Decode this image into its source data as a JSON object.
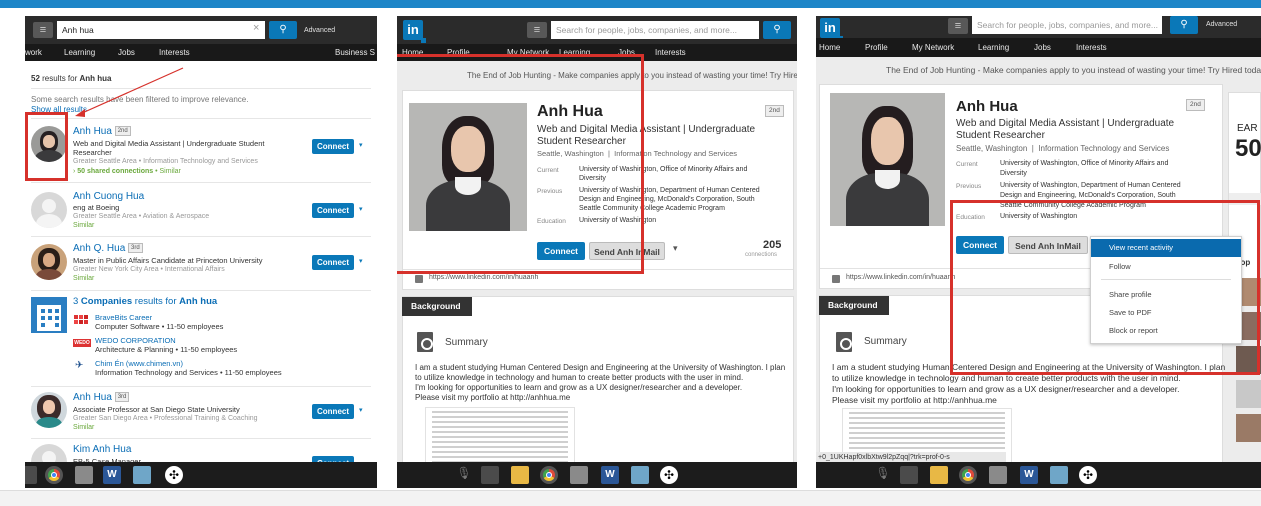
{
  "colors": {
    "accent": "#0a78b8",
    "highlight_box": "#d6312b",
    "shared": "#6aa83c"
  },
  "search_panel": {
    "query": "Anh hua",
    "clear_label": "×",
    "advanced_label": "Advanced",
    "nav": [
      "work",
      "Learning",
      "Jobs",
      "Interests",
      "Business S"
    ],
    "results_count": "52",
    "results_text": " results for ",
    "results_query": "Anh hua",
    "filter_notice": "Some search results have been filtered to improve relevance.",
    "show_all_label": "Show all results",
    "connect_label": "Connect",
    "people": [
      {
        "first": "Anh",
        "last": " Hua",
        "degree": "2nd",
        "headline1": "Web and Digital Media Assistant | Undergraduate Student",
        "headline2": "Researcher",
        "location": "Greater Seattle Area • Information Technology and Services",
        "extra": "50 shared connections",
        "similar": "Similar"
      },
      {
        "first": "Anh",
        "last": " Cuong Hua",
        "degree": "",
        "headline1": "eng at Boeing",
        "headline2": "",
        "location": "Greater Seattle Area • Aviation & Aerospace",
        "extra": "",
        "similar": "Similar"
      },
      {
        "first": "Anh",
        "last": " Q. Hua",
        "degree": "3rd",
        "headline1": "Master in Public Affairs Candidate at Princeton University",
        "headline2": "",
        "location": "Greater New York City Area • International Affairs",
        "extra": "",
        "similar": "Similar"
      },
      {
        "first": "Anh",
        "last": " Hua",
        "degree": "3rd",
        "headline1": "Associate Professor at San Diego State University",
        "headline2": "",
        "location": "Greater San Diego Area • Professional Training & Coaching",
        "extra": "",
        "similar": "Similar"
      },
      {
        "first": "Kim",
        "last": " Anh Hua",
        "degree": "",
        "headline1": "EB-5 Case Manager",
        "headline2": "",
        "location": "",
        "extra": "",
        "similar": ""
      }
    ],
    "companies": {
      "count": "3",
      "heading_mid": " Companies",
      "heading_tail": " results for ",
      "heading_query": "Anh hua",
      "items": [
        {
          "name": "BraveBits Career",
          "industry": "Computer Software",
          "size": "11-50 employees"
        },
        {
          "name": "WEDO CORPORATION",
          "industry": "Architecture & Planning",
          "size": "11-50 employees"
        },
        {
          "name": "Chim Én (www.chimen.vn)",
          "industry": "Information Technology and Services",
          "size": "11-50 employees"
        }
      ]
    }
  },
  "profile": {
    "search_placeholder": "Search for people, jobs, companies, and more...",
    "logo": "in",
    "nav": [
      "Home",
      "Profile",
      "My Network",
      "Learning",
      "Jobs",
      "Interests"
    ],
    "banner": "The End of Job Hunting - Make companies apply to you instead of wasting your time! Try Hired today",
    "name": "Anh Hua",
    "degree": "2nd",
    "headline1": "Web and Digital Media Assistant | Undergraduate",
    "headline2": "Student Researcher",
    "location": "Seattle, Washington",
    "industry": "Information Technology and Services",
    "current_label": "Current",
    "current1": "University of Washington, Office of Minority Affairs and",
    "current2": "Diversity",
    "previous_label": "Previous",
    "previous1": "University of Washington, Department of Human Centered",
    "previous2": "Design and Engineering, McDonald's Corporation, South",
    "previous3": "Seattle Community College Academic Program",
    "education_label": "Education",
    "education": "University of Washington",
    "connect_label": "Connect",
    "inmail_label": "Send Anh InMail",
    "connections": "205",
    "connections_label": "connections",
    "url": "https://www.linkedin.com/in/huaanh",
    "background_tab": "Background",
    "summary_title": "Summary",
    "summary1": "I am a student studying Human Centered Design and Engineering at the University of Washington. I plan",
    "summary2": "to utilize knowledge in technology and human to create better products with the user in mind.",
    "summary3": "I'm looking for opportunities to learn and grow as a UX designer/researcher and a developer.",
    "summary4": "Please visit my portfolio at http://anhhua.me"
  },
  "panel3": {
    "banner": "The End of Job Hunting - Make companies apply to you instead of wasting your time! Try Hired toda",
    "status_url": "+0_1UKHapf0xlbXtw9l2pZqq|?trk=prof-0-s",
    "ad_text1": "EAR",
    "ad_text2": "50",
    "side_label": "eop",
    "menu": [
      "View recent activity",
      "Follow",
      "Share profile",
      "Save to PDF",
      "Block or report"
    ]
  }
}
